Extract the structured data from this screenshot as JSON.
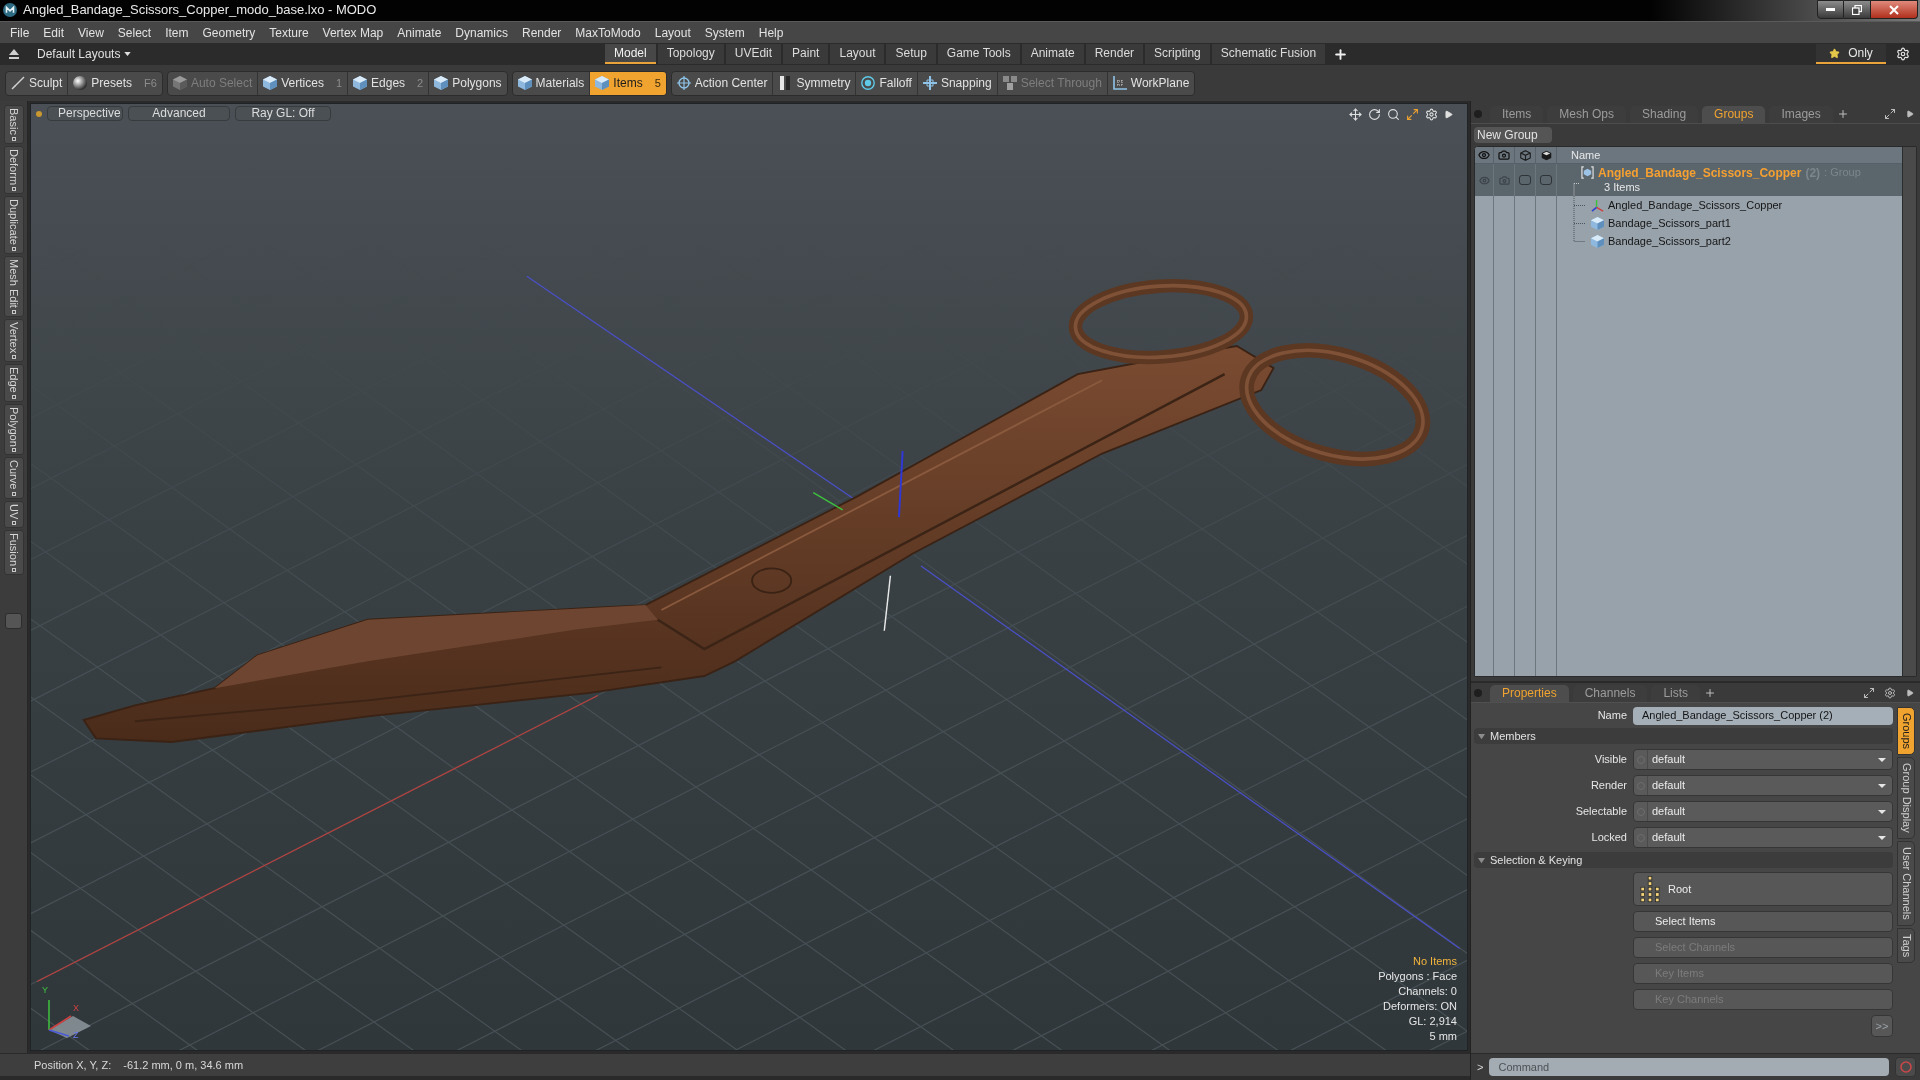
{
  "window": {
    "title": "Angled_Bandage_Scissors_Copper_modo_base.lxo - MODO"
  },
  "menu": [
    "File",
    "Edit",
    "View",
    "Select",
    "Item",
    "Geometry",
    "Texture",
    "Vertex Map",
    "Animate",
    "Dynamics",
    "Render",
    "MaxToModo",
    "Layout",
    "System",
    "Help"
  ],
  "layout_bar": {
    "layouts": "Default Layouts",
    "tabs": [
      {
        "label": "Model",
        "selected": true
      },
      {
        "label": "Topology",
        "selected": false
      },
      {
        "label": "UVEdit",
        "selected": false
      },
      {
        "label": "Paint",
        "selected": false
      },
      {
        "label": "Layout",
        "selected": false
      },
      {
        "label": "Setup",
        "selected": false
      },
      {
        "label": "Game Tools",
        "selected": false
      },
      {
        "label": "Animate",
        "selected": false
      },
      {
        "label": "Render",
        "selected": false
      },
      {
        "label": "Scripting",
        "selected": false
      },
      {
        "label": "Schematic Fusion",
        "selected": false
      }
    ],
    "only": "Only"
  },
  "toolbar": [
    {
      "buttons": [
        {
          "label": "Sculpt",
          "selected": false,
          "disabled": false
        },
        {
          "label": "Presets",
          "key": "F6",
          "selected": false,
          "disabled": false
        }
      ]
    },
    {
      "buttons": [
        {
          "label": "Auto Select",
          "selected": false,
          "disabled": true
        },
        {
          "label": "Vertices",
          "key": "1",
          "selected": false,
          "disabled": false
        },
        {
          "label": "Edges",
          "key": "2",
          "selected": false,
          "disabled": false
        },
        {
          "label": "Polygons",
          "selected": false,
          "disabled": false
        }
      ]
    },
    {
      "buttons": [
        {
          "label": "Materials",
          "selected": false,
          "disabled": false
        },
        {
          "label": "Items",
          "key": "5",
          "selected": true,
          "disabled": false
        }
      ]
    },
    {
      "buttons": [
        {
          "label": "Action Center",
          "selected": false,
          "disabled": false
        },
        {
          "label": "Symmetry",
          "selected": false,
          "disabled": false
        },
        {
          "label": "Falloff",
          "selected": false,
          "disabled": false
        },
        {
          "label": "Snapping",
          "selected": false,
          "disabled": false
        },
        {
          "label": "Select Through",
          "selected": false,
          "disabled": true
        },
        {
          "label": "WorkPlane",
          "selected": false,
          "disabled": false
        }
      ]
    }
  ],
  "side_tabs": [
    "Basic",
    "Deform",
    "Duplicate",
    "Mesh Edit",
    "Vertex",
    "Edge",
    "Polygon",
    "Curve",
    "UV",
    "Fusion"
  ],
  "viewport": {
    "buttons": [
      "Perspective",
      "Advanced",
      "Ray GL: Off"
    ],
    "gizmo_labels": [
      "Y",
      "X",
      "Z"
    ],
    "info": [
      {
        "text": "No Items",
        "highlighted": true
      },
      {
        "text": "Polygons : Face",
        "highlighted": false
      },
      {
        "text": "Channels: 0",
        "highlighted": false
      },
      {
        "text": "Deformers: ON",
        "highlighted": false
      },
      {
        "text": "GL: 2,914",
        "highlighted": false
      },
      {
        "text": "5 mm",
        "highlighted": false
      }
    ]
  },
  "status_bar": {
    "label": "Position X, Y, Z:",
    "value": "-61.2 mm, 0 m, 34.6 mm"
  },
  "scene_panel": {
    "tabs": [
      {
        "label": "Items",
        "selected": false
      },
      {
        "label": "Mesh Ops",
        "selected": false
      },
      {
        "label": "Shading",
        "selected": false
      },
      {
        "label": "Groups",
        "selected": true
      },
      {
        "label": "Images",
        "selected": false
      }
    ],
    "new_group": "New Group",
    "column": "Name",
    "groups": [
      {
        "name": "Angled_Bandage_Scissors_Copper",
        "count": "(2)",
        "type": ": Group",
        "summary": "3 Items",
        "selected": true,
        "children": [
          {
            "name": "Angled_Bandage_Scissors_Copper",
            "kind": "locator",
            "selected": false
          },
          {
            "name": "Bandage_Scissors_part1",
            "kind": "mesh",
            "selected": false
          },
          {
            "name": "Bandage_Scissors_part2",
            "kind": "mesh",
            "selected": false
          }
        ]
      }
    ]
  },
  "properties": {
    "tabs": [
      {
        "label": "Properties",
        "selected": true
      },
      {
        "label": "Channels",
        "selected": false
      },
      {
        "label": "Lists",
        "selected": false
      }
    ],
    "name_label": "Name",
    "name": "Angled_Bandage_Scissors_Copper (2)",
    "sections": [
      {
        "title": "Members",
        "expanded": true,
        "kind": "fields",
        "rows": [
          {
            "label": "Visible",
            "value": "default"
          },
          {
            "label": "Render",
            "value": "default"
          },
          {
            "label": "Selectable",
            "value": "default"
          },
          {
            "label": "Locked",
            "value": "default"
          }
        ]
      },
      {
        "title": "Selection & Keying",
        "expanded": true,
        "kind": "buttons",
        "buttons": [
          {
            "label": "Root",
            "kind": "root",
            "disabled": false
          },
          {
            "label": "Select Items",
            "kind": "plain",
            "disabled": false
          },
          {
            "label": "Select Channels",
            "kind": "plain",
            "disabled": true
          },
          {
            "label": "Key Items",
            "kind": "plain",
            "disabled": true
          },
          {
            "label": "Key Channels",
            "kind": "plain",
            "disabled": true
          }
        ]
      }
    ],
    "more": ">>",
    "side_tabs": [
      {
        "label": "Groups",
        "selected": true
      },
      {
        "label": "Group Display",
        "selected": false
      },
      {
        "label": "User Channels",
        "selected": false
      },
      {
        "label": "Tags",
        "selected": false
      }
    ]
  },
  "command": {
    "prompt": ">",
    "placeholder": "Command"
  }
}
